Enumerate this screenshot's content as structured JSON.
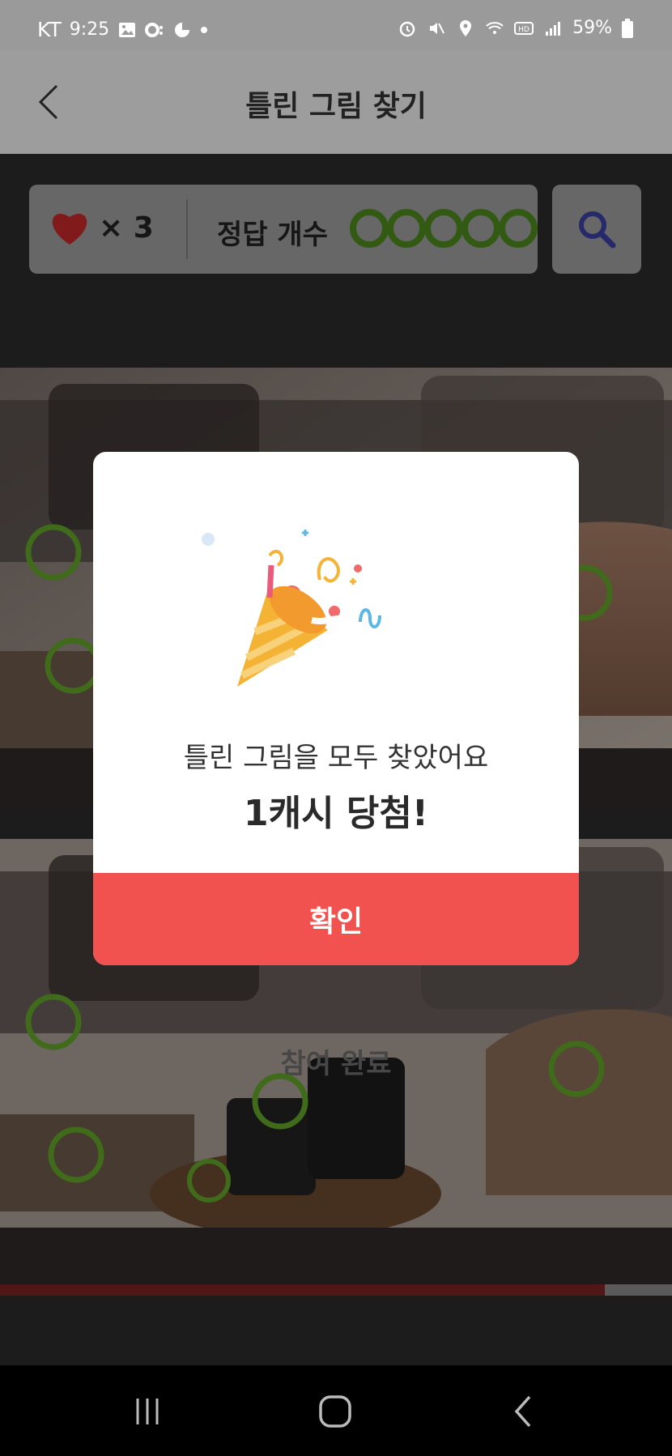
{
  "status_bar": {
    "carrier": "KT",
    "time": "9:25",
    "battery": "59%"
  },
  "header": {
    "title": "틀린 그림 찾기"
  },
  "game": {
    "lives_label": "× 3",
    "answers_label": "정답 개수",
    "answers_found": 5,
    "answers_total": 5,
    "done_label": "참여 완료",
    "progress": 0.9
  },
  "modal": {
    "message": "틀린 그림을 모두 찾았어요",
    "prize": "1캐시 당첨!",
    "confirm_label": "확인"
  },
  "colors": {
    "accent": "#f1514f",
    "circle": "#4e8b1e",
    "search_icon": "#3b3fa3",
    "heart": "#c62828"
  }
}
